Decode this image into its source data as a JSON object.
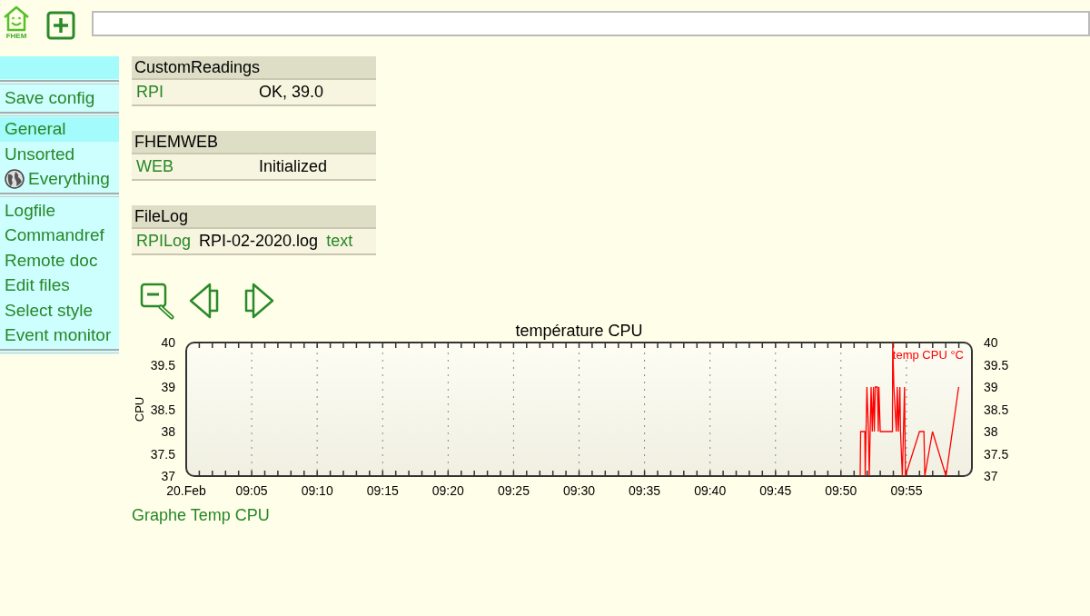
{
  "header": {
    "logo_label": "FHEM"
  },
  "menu": {
    "groups": [
      [
        {
          "label": "Save config",
          "selected": false,
          "kind": "plain"
        }
      ],
      [
        {
          "label": "General",
          "selected": true,
          "kind": "plain"
        },
        {
          "label": "Unsorted",
          "selected": false,
          "kind": "plain"
        },
        {
          "label": "Everything",
          "selected": false,
          "kind": "globe"
        }
      ],
      [
        {
          "label": "Logfile",
          "selected": false,
          "kind": "plain"
        },
        {
          "label": "Commandref",
          "selected": false,
          "kind": "plain"
        },
        {
          "label": "Remote doc",
          "selected": false,
          "kind": "plain"
        },
        {
          "label": "Edit files",
          "selected": false,
          "kind": "plain"
        },
        {
          "label": "Select style",
          "selected": false,
          "kind": "plain"
        },
        {
          "label": "Event monitor",
          "selected": false,
          "kind": "plain"
        }
      ]
    ]
  },
  "tables": [
    {
      "title": "CustomReadings",
      "rows": [
        {
          "cells": [
            {
              "text": "RPI",
              "link": true
            },
            {
              "text": "OK, 39.0",
              "link": false
            }
          ]
        }
      ]
    },
    {
      "title": "FHEMWEB",
      "rows": [
        {
          "cells": [
            {
              "text": "WEB",
              "link": true
            },
            {
              "text": "Initialized",
              "link": false
            }
          ]
        }
      ]
    },
    {
      "title": "FileLog",
      "rows": [
        {
          "cells": [
            {
              "text": "RPILog",
              "link": true
            },
            {
              "text": "RPI-02-2020.log",
              "link": false
            },
            {
              "text": "text",
              "link": true
            }
          ]
        }
      ]
    }
  ],
  "plot": {
    "link": "Graphe Temp CPU",
    "chart_data": {
      "type": "line",
      "title": "température CPU",
      "ylabel": "CPU",
      "grid": true,
      "xlim": [
        540,
        600
      ],
      "ylim": [
        37,
        40
      ],
      "y2lim": [
        37,
        40
      ],
      "xticks": [
        {
          "value": 540,
          "label": "20.Feb"
        },
        {
          "value": 545,
          "label": "09:05"
        },
        {
          "value": 550,
          "label": "09:10"
        },
        {
          "value": 555,
          "label": "09:15"
        },
        {
          "value": 560,
          "label": "09:20"
        },
        {
          "value": 565,
          "label": "09:25"
        },
        {
          "value": 570,
          "label": "09:30"
        },
        {
          "value": 575,
          "label": "09:35"
        },
        {
          "value": 580,
          "label": "09:40"
        },
        {
          "value": 585,
          "label": "09:45"
        },
        {
          "value": 590,
          "label": "09:50"
        },
        {
          "value": 595,
          "label": "09:55"
        }
      ],
      "yticks": [
        37,
        37.5,
        38,
        38.5,
        39,
        39.5,
        40
      ],
      "y2ticks": [
        37,
        37.5,
        38,
        38.5,
        39,
        39.5,
        40
      ],
      "x": [
        591.47,
        591.5,
        591.82,
        591.85,
        591.98,
        592.1,
        592.16,
        592.3,
        592.39,
        592.48,
        592.55,
        592.62,
        592.78,
        592.85,
        592.9,
        593.0,
        593.08,
        593.93,
        593.95,
        594.04,
        594.23,
        594.3,
        594.39,
        594.5,
        594.55,
        594.69,
        594.85,
        594.92,
        596.0,
        596.34,
        596.4,
        596.99,
        598.02,
        598.99
      ],
      "series": [
        {
          "name": "temp CPU °C",
          "color": "#ff0000",
          "values": [
            37,
            38,
            38,
            37,
            39,
            38,
            37,
            39,
            38,
            39,
            38,
            39,
            39,
            38,
            39,
            38,
            38,
            38,
            40,
            39,
            38,
            39,
            38,
            39,
            38,
            37,
            39,
            37,
            38,
            38,
            37,
            38,
            37,
            39
          ]
        }
      ]
    }
  }
}
